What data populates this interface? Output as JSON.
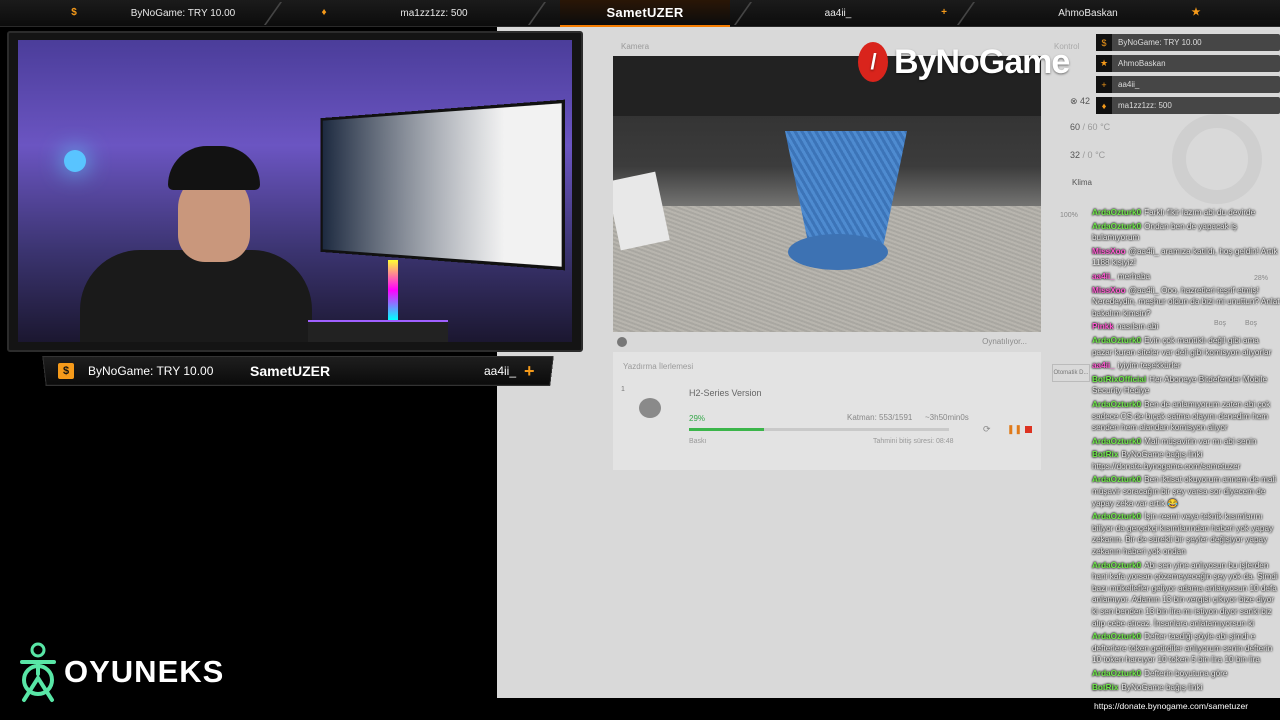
{
  "topbar": {
    "items": [
      {
        "text": "ByNoGame: TRY 10.00"
      },
      {
        "text": "ma1zz1zz: 500"
      },
      {
        "text": "SametUZER"
      },
      {
        "text": "aa4ii_"
      },
      {
        "text": "AhmoBaskan"
      }
    ],
    "accent": "#f57c00"
  },
  "cambar": {
    "left": "ByNoGame: TRY 10.00",
    "center": "SametUZER",
    "right": "aa4ii_"
  },
  "printer_ui": {
    "camera_label": "Kamera",
    "status": "Oynatılıyor...",
    "queue_title": "Yazdırma İlerlemesi",
    "job_index": "1",
    "job_name": "H2-Series Version",
    "progress_text": "29%",
    "progress_value": 0.29,
    "layer": "Katman: 553/1591",
    "time_left": "~3h50min0s",
    "job_type": "Baskı",
    "finish": "Tahmini bitiş süresi: 08:48",
    "control_label": "Kontrol",
    "temp1": "42",
    "temp2": "60",
    "temp2_target": "/ 60",
    "temp3": "32",
    "temp3_target": "/ 0",
    "unit": "°C",
    "klima": "Klima",
    "fan_pct": "100%",
    "otomatik": "Otomatik D...",
    "bos1": "Boş",
    "bos2": "Boş",
    "pct28": "28%"
  },
  "brand": {
    "logo_text": "ByNoGame",
    "color": "#d9241c"
  },
  "alerts": [
    {
      "icon": "dollar-icon",
      "text": "ByNoGame: TRY 10.00"
    },
    {
      "icon": "star-icon",
      "text": "AhmoBaskan"
    },
    {
      "icon": "plus-icon",
      "text": "aa4ii_"
    },
    {
      "icon": "flame-icon",
      "text": "ma1zz1zz: 500"
    }
  ],
  "chat": [
    {
      "user": "ArdaOzturk0",
      "color": "#6fe84a",
      "text": "Farklı fikir lazım abi du devirde"
    },
    {
      "user": "ArdaOzturk0",
      "color": "#6fe84a",
      "text": "Ondan ben de yapacak iş bulamıyorum"
    },
    {
      "user": "MissXoo",
      "color": "#ff5ad2",
      "text": "@aa4ii_ aramıza katıldı, hoş geldin! Artık 1188 kişiyiz!"
    },
    {
      "user": "aa4ii_",
      "color": "#ff5ad2",
      "text": "merhaba"
    },
    {
      "user": "MissXoo",
      "color": "#ff5ad2",
      "text": "@aa4ii_ Ooo, hazretleri teşrif etmiş! Neredeydin, meşhur oldun da bizi mi unuttun? Anlat bakalım kimsin?"
    },
    {
      "user": "Pinkk",
      "color": "#ff5ad2",
      "text": "nasılsın abi"
    },
    {
      "user": "ArdaOzturk0",
      "color": "#6fe84a",
      "text": "Evin çok mantıklı değil gibi ama pazar kuran siteler var deli gibi komisyon alıyorlar"
    },
    {
      "user": "aa4ii_",
      "color": "#ff5ad2",
      "text": "iyiyim teşekkürler"
    },
    {
      "user": "BotRixOfficial",
      "color": "#6fe84a",
      "text": "Her Aboneye Bitdefender Mobile Security Hediye"
    },
    {
      "user": "ArdaOzturk0",
      "color": "#6fe84a",
      "text": "Ben de anlamıyorum zaten abi çok sadece CS de bıçak satma olayını denedim hem senden hem alandan komisyon alıyor"
    },
    {
      "user": "ArdaOzturk0",
      "color": "#6fe84a",
      "text": "Mali müşavirin var mı abi senin"
    },
    {
      "user": "BotRix",
      "color": "#6fe84a",
      "text": "ByNoGame bağış linki https://donate.bynogame.com/sametuzer"
    },
    {
      "user": "ArdaOzturk0",
      "color": "#6fe84a",
      "text": "Ben iktisat okuyorum annem de mali müşavir soracağın bir şey varsa sor diyecem de yapay zeka var artık 😂"
    },
    {
      "user": "ArdaOzturk0",
      "color": "#6fe84a",
      "text": "İşin resmi veya teknik kısımlarını biliyor da gerçekçi kısımlarından haberi yok yapay zekanın. Bir de sürekli bir şeyler değişiyor yapay zekanın haberi yok ondan"
    },
    {
      "user": "ArdaOzturk0",
      "color": "#6fe84a",
      "text": "Abi sen yine anlıyosun bu işlerden hani kafa yorsan çözemeyeceğin şey yok da. Şimdi bazı mükellefler geliyor adama anlatıyosun 10 defa anlamıyor. Adamın 13 bin vergisi çıkıyor bize diyor ki sen benden 13 bin lira mı istiyon diyor sanki biz alıp cebe atıcaz. İnsanlara anlatamıyorsun ki"
    },
    {
      "user": "ArdaOzturk0",
      "color": "#6fe84a",
      "text": "Defter tasdiği şöyle abi şimdi e defterlere token getirdiler anlıyorum senin defterin 10 token harcıyor 10 token 5 bin lira 10 bin lira"
    },
    {
      "user": "ArdaOzturk0",
      "color": "#6fe84a",
      "text": "Defterin boyutuna göre"
    },
    {
      "user": "BotRix",
      "color": "#6fe84a",
      "text": "ByNoGame bağış linki"
    }
  ],
  "chat_link": "https://donate.bynogame.com/sametuzer",
  "bottom_logo": {
    "text": "OYUNEKS",
    "color": "#58e6a6"
  }
}
